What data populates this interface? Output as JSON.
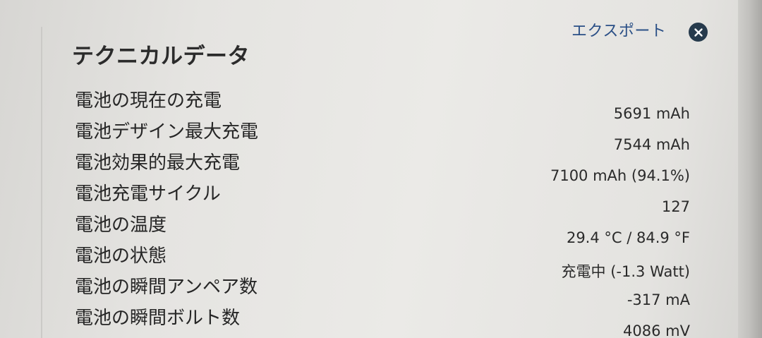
{
  "header": {
    "export_label": "エクスポート",
    "close_icon": "close-icon"
  },
  "panel": {
    "title": "テクニカルデータ"
  },
  "rows": [
    {
      "label": "電池の現在の充電",
      "value": "5691 mAh"
    },
    {
      "label": "電池デザイン最大充電",
      "value": "7544 mAh"
    },
    {
      "label": "電池効果的最大充電",
      "value": "7100 mAh (94.1%)"
    },
    {
      "label": "電池充電サイクル",
      "value": "127"
    },
    {
      "label": "電池の温度",
      "value": "29.4 °C / 84.9 °F"
    },
    {
      "label": "電池の状態",
      "value": "充電中 (-1.3 Watt)"
    },
    {
      "label": "電池の瞬間アンペア数",
      "value": "-317 mA"
    },
    {
      "label": "電池の瞬間ボルト数",
      "value": "4086 mV"
    }
  ],
  "colors": {
    "accent": "#2a4f86",
    "close_bg": "#263a4c"
  }
}
